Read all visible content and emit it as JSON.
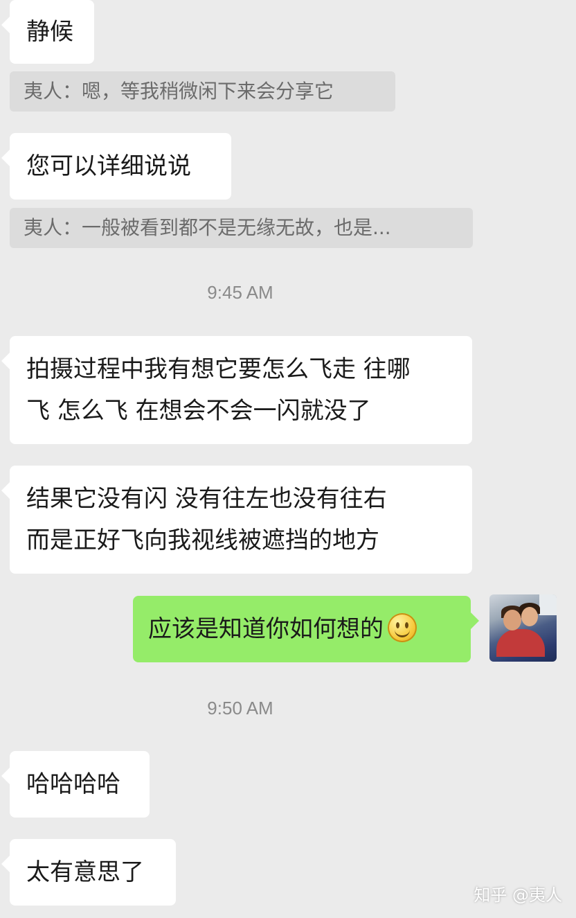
{
  "messages": {
    "m1": "静候",
    "q1": "夷人：嗯，等我稍微闲下来会分享它",
    "m2": "您可以详细说说",
    "q2": "夷人：一般被看到都不是无缘无故，也是...",
    "t1": "9:45 AM",
    "m3_line1": "拍摄过程中我有想它要怎么飞走 往哪",
    "m3_line2": "飞 怎么飞 在想会不会一闪就没了",
    "m4_line1": "结果它没有闪 没有往左也没有往右",
    "m4_line2": "而是正好飞向我视线被遮挡的地方",
    "m5": "应该是知道你如何想的",
    "t2": "9:50 AM",
    "m6": "哈哈哈哈",
    "m7": "太有意思了"
  },
  "icons": {
    "emoji": "smile-emoji-icon",
    "avatar": "user-avatar-photo"
  },
  "watermark": "知乎 @夷人",
  "colors": {
    "background": "#ebebeb",
    "incoming_bubble": "#ffffff",
    "outgoing_bubble": "#95ec69",
    "quote_bg": "#dcdcdc",
    "timestamp": "#8a8a8a"
  }
}
